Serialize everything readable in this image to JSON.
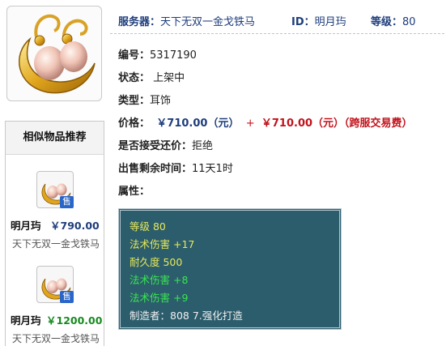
{
  "item_image": "gold-pearl-earring-icon",
  "header": {
    "server_label": "服务器：",
    "server_value": "天下无双一金戈铁马",
    "id_label": "ID：",
    "id_value": "明月玙",
    "level_label": "等级：",
    "level_value": "80"
  },
  "details": {
    "number_label": "编号：",
    "number_value": "5317190",
    "status_label": "状态：",
    "status_value": "上架中",
    "type_label": "类型：",
    "type_value": "耳饰",
    "price_label": "价格：",
    "price_value": "￥710.00（元）",
    "price_plus": "+",
    "price_fee": "￥710.00（元）（跨服交易费）",
    "bargain_label": "是否接受还价：",
    "bargain_value": "拒绝",
    "remaining_label": "出售剩余时间：",
    "remaining_value": "11天1时",
    "attributes_label": "属性："
  },
  "attributes": [
    {
      "text": "等级 80",
      "color": "#e6e95a"
    },
    {
      "text": "法术伤害 +17",
      "color": "#e6e95a"
    },
    {
      "text": "耐久度 500",
      "color": "#e6e95a"
    },
    {
      "text": "法术伤害 +8",
      "color": "#38e650"
    },
    {
      "text": "法术伤害 +9",
      "color": "#38e650"
    },
    {
      "text": "制造者：808 7.强化打造",
      "color": "#f0f0f0"
    }
  ],
  "sidebar": {
    "title": "相似物品推荐",
    "items": [
      {
        "badge": "售",
        "name": "明月玙",
        "price": "￥790.00",
        "server": "天下无双一金戈铁马"
      },
      {
        "badge": "售",
        "name": "明月玙",
        "price": "￥1200.00",
        "server": "天下无双一金戈铁马"
      }
    ]
  },
  "colors": {
    "header_blue": "#1e3d7b",
    "price_red": "#c1121b",
    "attr_bg": "#2c5d6c"
  }
}
